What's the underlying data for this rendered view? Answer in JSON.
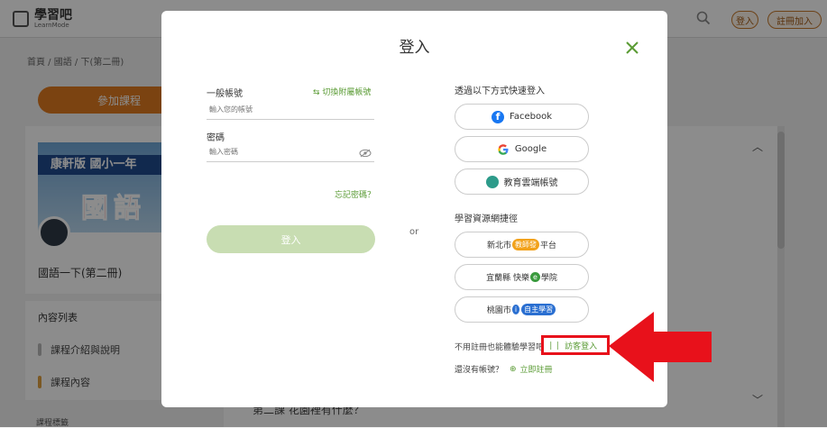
{
  "site": {
    "logo_name": "學習吧",
    "logo_sub": "LearnMode",
    "login_label": "登入",
    "register_label": "註冊加入"
  },
  "breadcrumb": "首頁 / 國語 / 下(第二冊)",
  "page": {
    "join_label": "參加課程",
    "cover_band": "康軒版 國小一年",
    "cover_big": "國語",
    "course_title": "國語一下(第二冊)",
    "list_header": "內容列表",
    "list_items": [
      "課程介紹與說明",
      "課程內容"
    ],
    "lesson_title": "第二課 花園裡有什麼？",
    "bottom_label": "課程標籤"
  },
  "modal": {
    "title": "登入",
    "account_label": "一般帳號",
    "switch_label": "切換附屬帳號",
    "account_placeholder": "輸入您的帳號",
    "password_label": "密碼",
    "password_placeholder": "輸入密碼",
    "forgot_label": "忘記密碼？",
    "login_button": "登入",
    "or_label": "or",
    "quick_login_title": "透過以下方式快速登入",
    "quick_login": [
      "Facebook",
      "Google",
      "教育雲端帳號"
    ],
    "resource_title": "學習資源網捷徑",
    "resources": [
      {
        "prefix": "新北市",
        "tag": "教師發",
        "suffix": "平台"
      },
      {
        "prefix": "宜蘭縣 快樂",
        "tag": "e",
        "suffix": "學院"
      },
      {
        "prefix": "桃園市",
        "tag": "i",
        "suffix": "自主學習"
      }
    ],
    "guest_note": "不用註冊也能體驗學習吧",
    "guest_label": "訪客登入",
    "no_account_note": "還沒有帳號？",
    "register_label": "立即註冊"
  },
  "colors": {
    "accent_green": "#5a9b34",
    "login_disabled": "#c8ddb2",
    "highlight_red": "#e8111b",
    "brand_orange": "#e07a1f"
  }
}
